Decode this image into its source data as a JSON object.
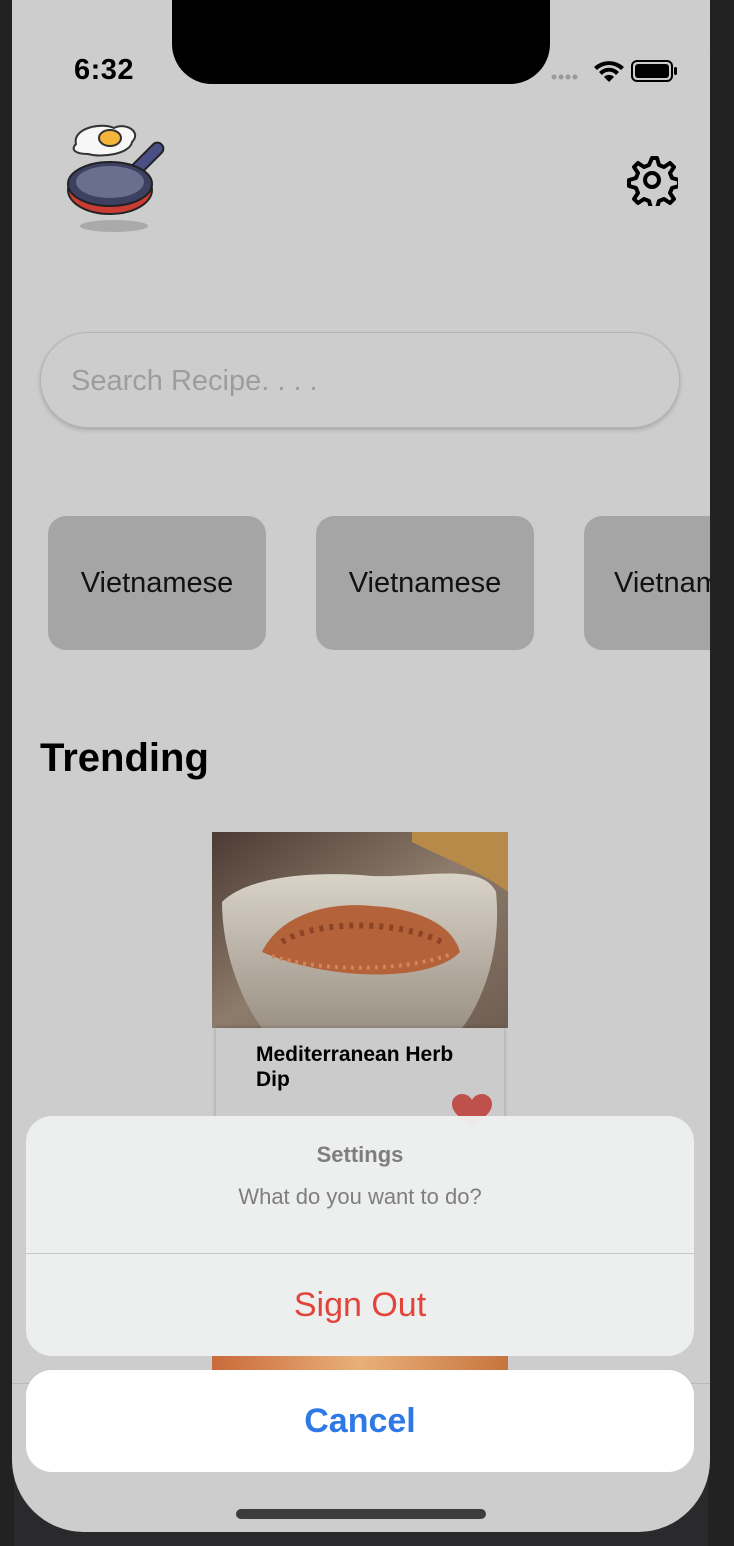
{
  "status_bar": {
    "time": "6:32"
  },
  "search": {
    "placeholder": "Search Recipe. . . ."
  },
  "categories": [
    {
      "label": "Vietnamese"
    },
    {
      "label": "Vietnamese"
    },
    {
      "label": "Vietnamese"
    }
  ],
  "section": {
    "title": "Trending"
  },
  "trending": [
    {
      "title": "Mediterranean Herb Dip"
    }
  ],
  "action_sheet": {
    "title": "Settings",
    "message": "What do you want to do?",
    "actions": [
      {
        "label": "Sign Out",
        "color": "#e2443a"
      }
    ],
    "cancel_label": "Cancel",
    "cancel_color": "#2f79e6"
  },
  "icons": {
    "logo": "frying-pan-egg-icon",
    "settings": "gear-icon",
    "favorite": "heart-icon"
  }
}
